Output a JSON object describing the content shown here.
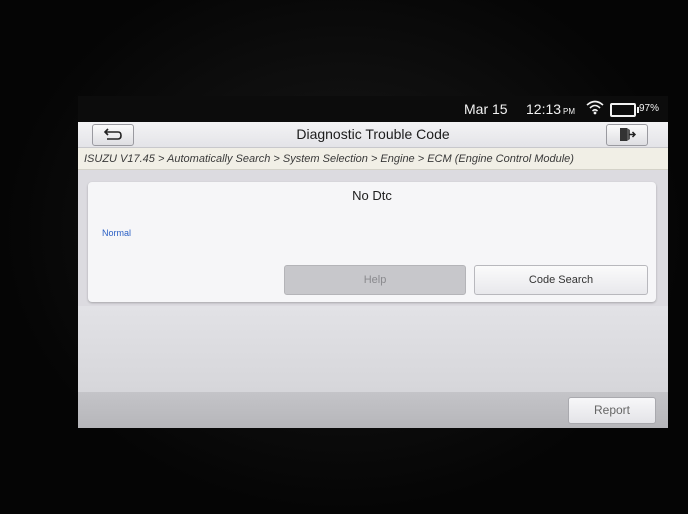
{
  "status_bar": {
    "date": "Mar 15",
    "time": "12:13",
    "ampm": "PM",
    "battery_percent": "97%",
    "icons": [
      "wifi-icon",
      "battery-icon"
    ]
  },
  "title_bar": {
    "title": "Diagnostic Trouble Code",
    "left_icon": "back-icon",
    "right_icon": "exit-icon"
  },
  "breadcrumb": "ISUZU V17.45 > Automatically Search > System Selection > Engine > ECM (Engine Control Module)",
  "panel": {
    "heading": "No Dtc",
    "status": "Normal",
    "buttons": {
      "help": "Help",
      "code_search": "Code Search"
    }
  },
  "bottom_bar": {
    "report": "Report"
  },
  "colors": {
    "status_text": "#2a5fc4",
    "disabled_button": "#c7c7cb"
  }
}
